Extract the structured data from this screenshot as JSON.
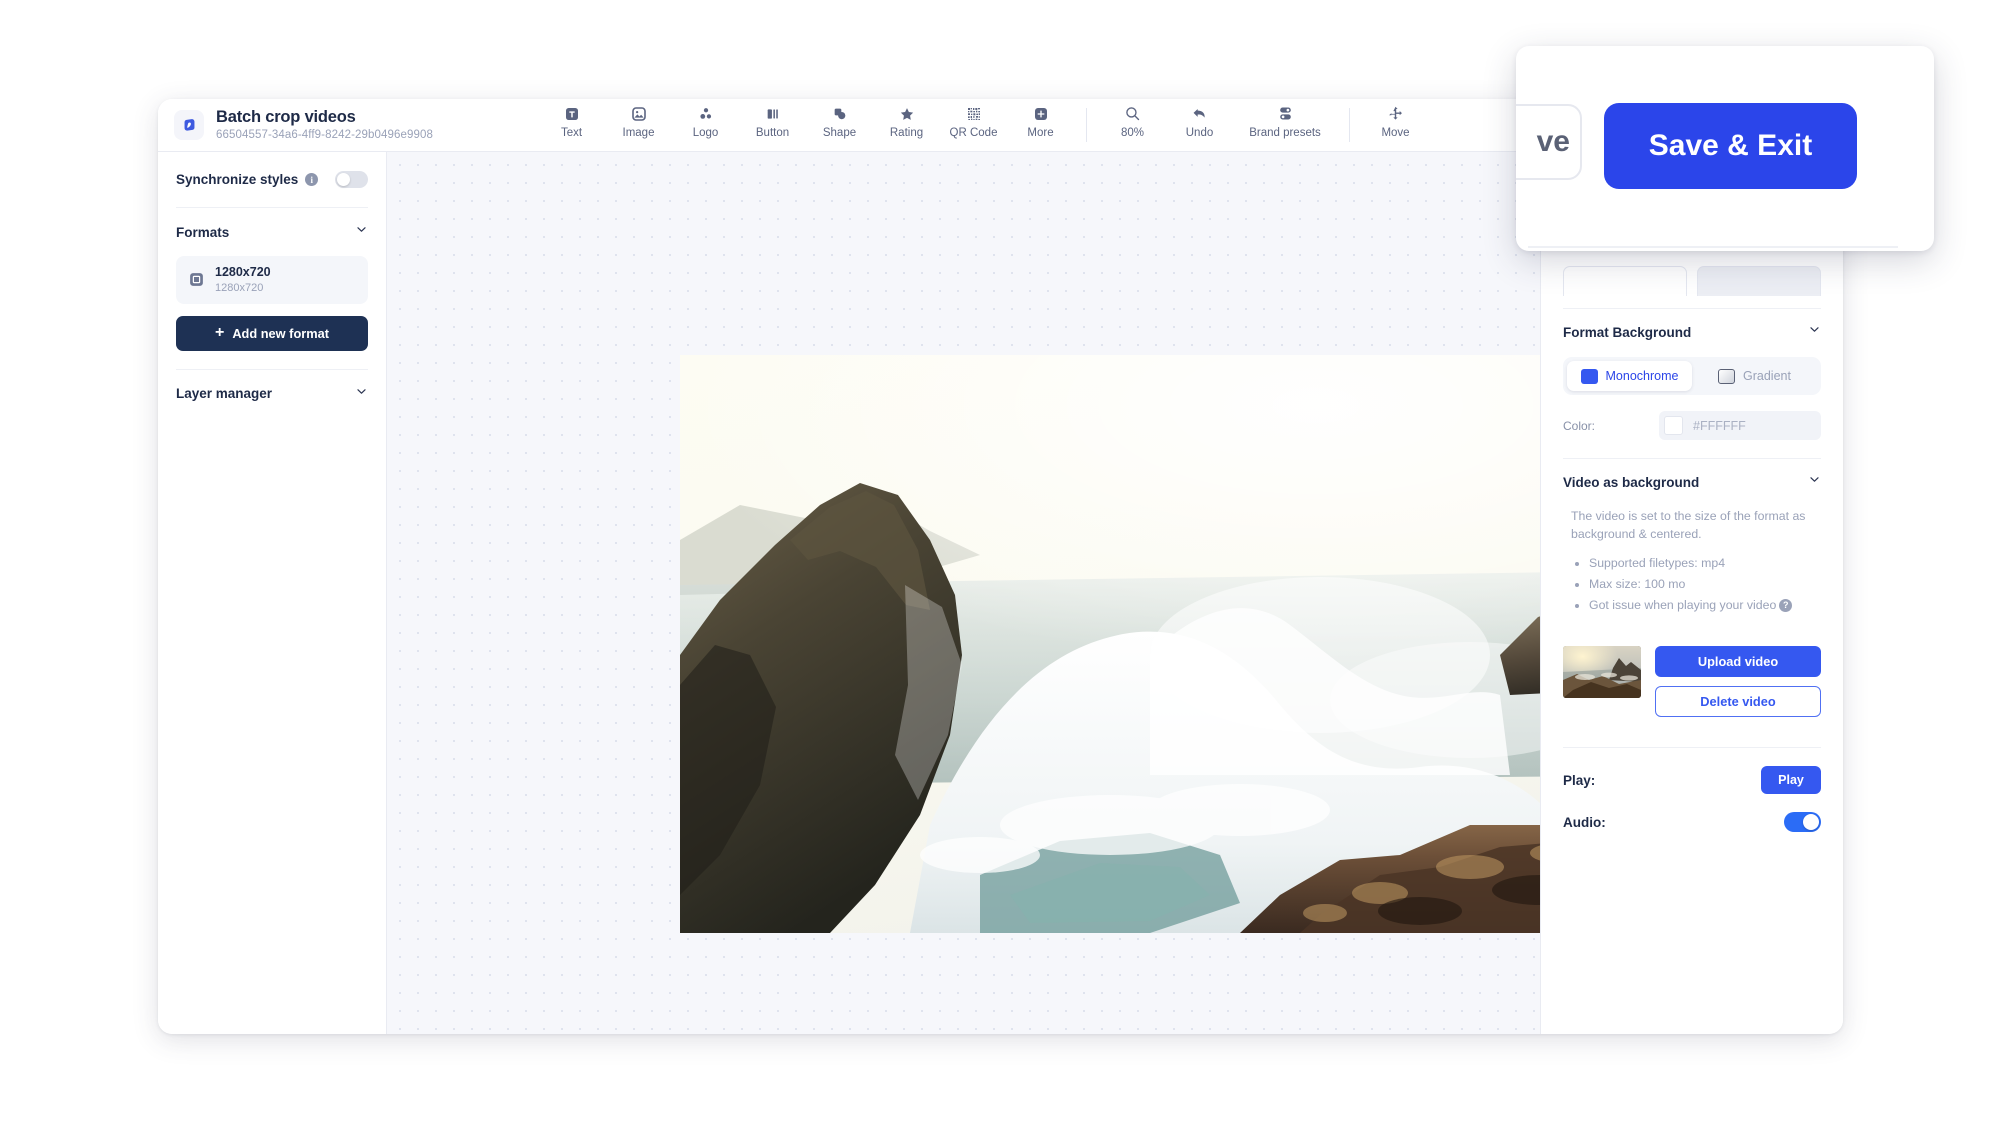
{
  "app": {
    "title": "Batch crop videos",
    "project_id": "66504557-34a6-4ff9-8242-29b0496e9908",
    "logo_icon": "app-logo-icon"
  },
  "toolbar": {
    "items": [
      {
        "label": "Text",
        "icon": "text-icon"
      },
      {
        "label": "Image",
        "icon": "image-icon"
      },
      {
        "label": "Logo",
        "icon": "logo-icon"
      },
      {
        "label": "Button",
        "icon": "button-icon"
      },
      {
        "label": "Shape",
        "icon": "shape-icon"
      },
      {
        "label": "Rating",
        "icon": "star-icon"
      },
      {
        "label": "QR Code",
        "icon": "qr-code-icon"
      },
      {
        "label": "More",
        "icon": "plus-square-icon"
      }
    ],
    "right_items": [
      {
        "label": "80%",
        "icon": "magnifier-icon"
      },
      {
        "label": "Undo",
        "icon": "undo-arrow-icon"
      },
      {
        "label": "Brand presets",
        "icon": "brand-presets-icon"
      },
      {
        "label": "Move",
        "icon": "move-icon"
      }
    ]
  },
  "left_panel": {
    "synchronize_styles_label": "Synchronize styles",
    "synchronize_styles_info": "i",
    "synchronize_styles_on": false,
    "formats_title": "Formats",
    "formats": [
      {
        "name": "1280x720",
        "dimensions": "1280x720"
      }
    ],
    "add_new_format_label": "Add new format",
    "layer_manager_title": "Layer manager"
  },
  "right_panel": {
    "format_background": {
      "title": "Format Background",
      "modes": [
        {
          "label": "Monochrome",
          "active": true,
          "swatch": "#3558f0"
        },
        {
          "label": "Gradient",
          "active": false,
          "swatch": "#cfd3db"
        }
      ],
      "color_label": "Color:",
      "color_value": "#FFFFFF"
    },
    "video_as_background": {
      "title": "Video as background",
      "description": "The video is set to the size of the format as background & centered.",
      "bullets": [
        "Supported filetypes: mp4",
        "Max size: 100 mo",
        "Got issue when playing your video"
      ],
      "help_badge": "?",
      "upload_label": "Upload video",
      "delete_label": "Delete video",
      "thumbnail_alt": "video-thumbnail"
    },
    "controls": {
      "play_label": "Play:",
      "play_button": "Play",
      "audio_label": "Audio:",
      "audio_on": true
    }
  },
  "overlay": {
    "partial_button_label": "ve",
    "save_exit_label": "Save & Exit"
  },
  "colors": {
    "accent": "#3558f0",
    "overlay_accent": "#2b45ea",
    "dark_button": "#1e3154",
    "text_dark": "#1e2a47",
    "text_muted": "#9aa2b8",
    "canvas_bg": "#f6f7fb"
  },
  "canvas": {
    "zoom": "80%",
    "format_label": "1280x720"
  }
}
